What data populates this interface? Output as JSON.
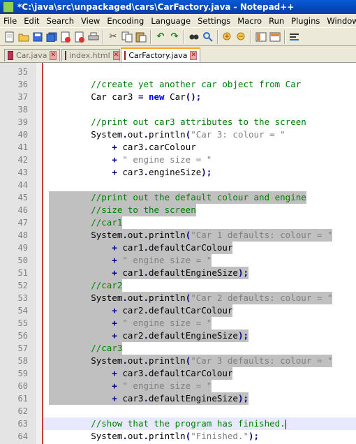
{
  "window": {
    "title": "*C:\\java\\src\\unpackaged\\cars\\CarFactory.java - Notepad++"
  },
  "menu": [
    "File",
    "Edit",
    "Search",
    "View",
    "Encoding",
    "Language",
    "Settings",
    "Macro",
    "Run",
    "Plugins",
    "Window",
    "?"
  ],
  "toolbar": {
    "icons": [
      "new-file-icon",
      "open-file-icon",
      "save-icon",
      "save-all-icon",
      "close-icon",
      "close-all-icon",
      "print-icon",
      "cut-icon",
      "copy-icon",
      "paste-icon",
      "undo-icon",
      "redo-icon",
      "find-icon",
      "replace-icon",
      "zoom-in-icon",
      "zoom-out-icon",
      "sync-vertical-icon",
      "sync-horizontal-icon",
      "word-wrap-icon"
    ]
  },
  "tabs": [
    {
      "label": "Car.java",
      "active": false
    },
    {
      "label": "index.html",
      "active": false
    },
    {
      "label": "CarFactory.java",
      "active": true
    }
  ],
  "colors": {
    "comment": "#008000",
    "keyword": "#0000ff",
    "string": "#808080",
    "selection": "#c0c0c0",
    "current_line": "#e8e8ff"
  },
  "editor": {
    "lines": [
      {
        "n": "35",
        "text": ""
      },
      {
        "n": "36",
        "text": "        //create yet another car object from Car"
      },
      {
        "n": "37",
        "text": "        Car car3 = new Car();"
      },
      {
        "n": "38",
        "text": ""
      },
      {
        "n": "39",
        "text": "        //print out car3 attributes to the screen"
      },
      {
        "n": "40",
        "text": "        System.out.println(\"Car 3: colour = \""
      },
      {
        "n": "41",
        "text": "            + car3.carColour"
      },
      {
        "n": "42",
        "text": "            + \" engine size = \""
      },
      {
        "n": "43",
        "text": "            + car3.engineSize);"
      },
      {
        "n": "44",
        "text": ""
      },
      {
        "n": "45",
        "text": "        //print out the default colour and engine"
      },
      {
        "n": "46",
        "text": "        //size to the screen"
      },
      {
        "n": "47",
        "text": "        //car1"
      },
      {
        "n": "48",
        "text": "        System.out.println(\"Car 1 defaults: colour = \""
      },
      {
        "n": "49",
        "text": "            + car1.defaultCarColour"
      },
      {
        "n": "50",
        "text": "            + \" engine size = \""
      },
      {
        "n": "51",
        "text": "            + car1.defaultEngineSize);"
      },
      {
        "n": "52",
        "text": "        //car2"
      },
      {
        "n": "53",
        "text": "        System.out.println(\"Car 2 defaults: colour = \""
      },
      {
        "n": "54",
        "text": "            + car2.defaultCarColour"
      },
      {
        "n": "55",
        "text": "            + \" engine size = \""
      },
      {
        "n": "56",
        "text": "            + car2.defaultEngineSize);"
      },
      {
        "n": "57",
        "text": "        //car3"
      },
      {
        "n": "58",
        "text": "        System.out.println(\"Car 3 defaults: colour = \""
      },
      {
        "n": "59",
        "text": "            + car3.defaultCarColour"
      },
      {
        "n": "60",
        "text": "            + \" engine size = \""
      },
      {
        "n": "61",
        "text": "            + car3.defaultEngineSize);"
      },
      {
        "n": "62",
        "text": ""
      },
      {
        "n": "63",
        "text": "        //show that the program has finished."
      },
      {
        "n": "64",
        "text": "        System.out.println(\"Finished.\");"
      }
    ],
    "selected_lines": [
      "45",
      "46",
      "47",
      "48",
      "49",
      "50",
      "51",
      "52",
      "53",
      "54",
      "55",
      "56",
      "57",
      "58",
      "59",
      "60",
      "61"
    ],
    "current_line": "63"
  }
}
